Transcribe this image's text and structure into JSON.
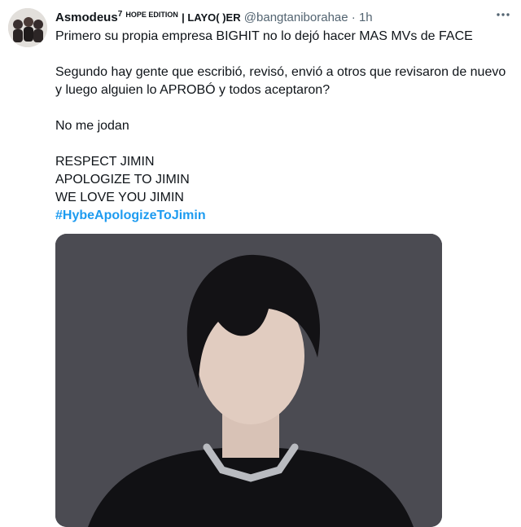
{
  "tweet": {
    "display_name": "Asmodeus",
    "name_sup": "7",
    "name_badge": "HOPE EDITION",
    "name_suffix": "| LAYO(   )ER",
    "handle": "@bangtaniborahae",
    "separator": "·",
    "time": "1h",
    "more_icon": "ellipsis-icon",
    "paragraphs": [
      "Primero su propia empresa BIGHIT no lo dejó hacer MAS MVs de FACE",
      "Segundo hay gente que escribió, revisó, envió a otros que revisaron de nuevo y luego alguien lo APROBÓ y todos aceptaron?",
      "No me jodan"
    ],
    "closing_lines": [
      "RESPECT JIMIN",
      "APOLOGIZE TO JIMIN",
      "WE LOVE YOU JIMIN"
    ],
    "hashtag": "#HybeApologizeToJimin"
  },
  "colors": {
    "accent": "#1d9bf0",
    "text": "#0f1419",
    "secondary_text": "#536471",
    "media_background": "#4b4b52"
  }
}
